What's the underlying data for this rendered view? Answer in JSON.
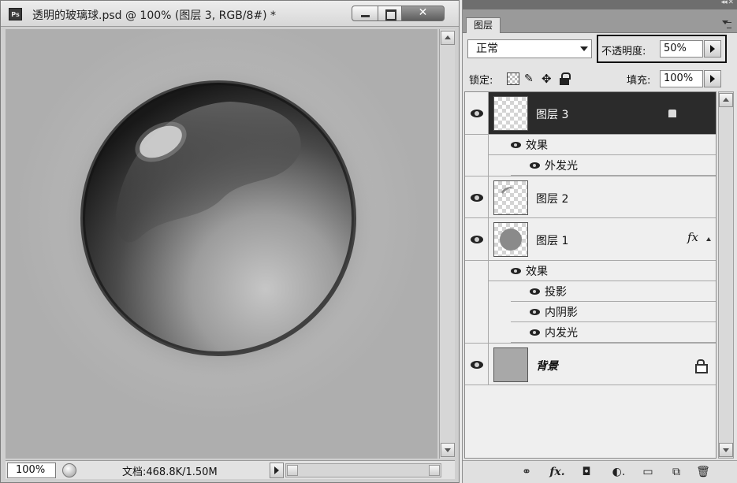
{
  "document": {
    "app_logo_text": "Ps",
    "title": "透明的玻璃球.psd @ 100% (图层 3, RGB/8#) *",
    "close_glyph": "✕",
    "zoom": "100%",
    "doc_info": "文档:468.8K/1.50M",
    "colors": {
      "canvas": "#b2b2b2",
      "sphere_dark": "#1e1e1e",
      "sphere_mid": "#7a7a7a",
      "sphere_light": "#c4c4c4"
    }
  },
  "panel": {
    "tab_label": "图层",
    "top_strip_glyph": "◂◂ ✕",
    "blend_mode": "正常",
    "opacity_label": "不透明度:",
    "opacity_value": "50%",
    "lock_label": "锁定:",
    "lock_icons": [
      "lock-transparent-icon",
      "lock-brush-icon",
      "lock-move-icon",
      "lock-all-icon"
    ],
    "lock_brush_glyph": "✎",
    "lock_move_glyph": "✥",
    "fill_label": "填充:",
    "fill_value": "100%",
    "layers": [
      {
        "name": "图层 3",
        "selected": true
      },
      {
        "name": "图层 2",
        "selected": false
      },
      {
        "name": "图层 1",
        "selected": false,
        "fx": "fx"
      },
      {
        "name": "背景",
        "selected": false,
        "locked": true
      }
    ],
    "layer3_effects": {
      "group": "效果",
      "items": [
        "外发光"
      ]
    },
    "layer1_effects": {
      "group": "效果",
      "items": [
        "投影",
        "内阴影",
        "内发光"
      ]
    },
    "footer_icons": [
      {
        "name": "link-icon",
        "glyph": "⚭"
      },
      {
        "name": "fx-icon",
        "glyph": "fx."
      },
      {
        "name": "mask-icon",
        "glyph": "◘"
      },
      {
        "name": "adjustment-icon",
        "glyph": "◐."
      },
      {
        "name": "group-folder-icon",
        "glyph": "▭"
      },
      {
        "name": "new-layer-icon",
        "glyph": "⧉"
      },
      {
        "name": "trash-icon",
        "glyph": "🗑"
      }
    ]
  }
}
